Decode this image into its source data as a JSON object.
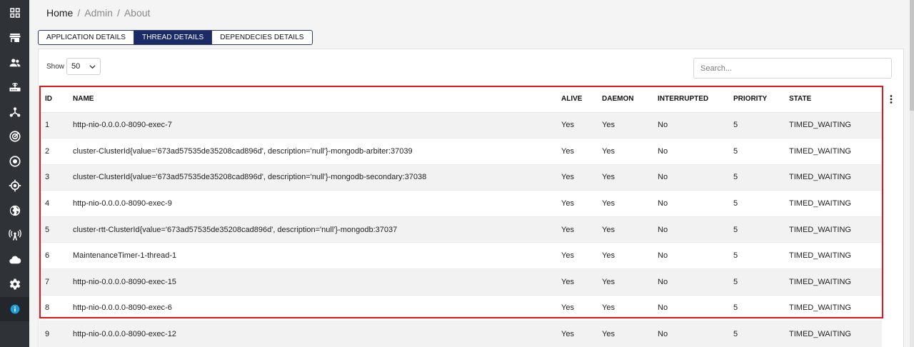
{
  "breadcrumb": {
    "home": "Home",
    "sep": "/",
    "admin": "Admin",
    "about": "About"
  },
  "tabs": [
    "APPLICATION DETAILS",
    "THREAD DETAILS",
    "DEPENDECIES DETAILS"
  ],
  "active_tab": "THREAD DETAILS",
  "controls": {
    "show_label": "Show",
    "show_value": "50",
    "search_placeholder": "Search..."
  },
  "sidebar": {
    "items": [
      "dashboard-icon",
      "store-icon",
      "users-icon",
      "router-icon",
      "network-icon",
      "radar-icon",
      "target-icon",
      "crosshair-icon",
      "globe-icon",
      "antenna-icon",
      "cloud-icon",
      "gear-icon",
      "info-icon"
    ],
    "active": "info-icon",
    "active_color": "#1e9bd7"
  },
  "table": {
    "columns": [
      "ID",
      "NAME",
      "ALIVE",
      "DAEMON",
      "INTERRUPTED",
      "PRIORITY",
      "STATE"
    ],
    "rows": [
      [
        "1",
        "http-nio-0.0.0.0-8090-exec-7",
        "Yes",
        "Yes",
        "No",
        "5",
        "TIMED_WAITING"
      ],
      [
        "2",
        "cluster-ClusterId{value='673ad57535de35208cad896d', description='null'}-mongodb-arbiter:37039",
        "Yes",
        "Yes",
        "No",
        "5",
        "TIMED_WAITING"
      ],
      [
        "3",
        "cluster-ClusterId{value='673ad57535de35208cad896d', description='null'}-mongodb-secondary:37038",
        "Yes",
        "Yes",
        "No",
        "5",
        "TIMED_WAITING"
      ],
      [
        "4",
        "http-nio-0.0.0.0-8090-exec-9",
        "Yes",
        "Yes",
        "No",
        "5",
        "TIMED_WAITING"
      ],
      [
        "5",
        "cluster-rtt-ClusterId{value='673ad57535de35208cad896d', description='null'}-mongodb:37037",
        "Yes",
        "Yes",
        "No",
        "5",
        "TIMED_WAITING"
      ],
      [
        "6",
        "MaintenanceTimer-1-thread-1",
        "Yes",
        "Yes",
        "No",
        "5",
        "TIMED_WAITING"
      ],
      [
        "7",
        "http-nio-0.0.0.0-8090-exec-15",
        "Yes",
        "Yes",
        "No",
        "5",
        "TIMED_WAITING"
      ],
      [
        "8",
        "http-nio-0.0.0.0-8090-exec-6",
        "Yes",
        "Yes",
        "No",
        "5",
        "TIMED_WAITING"
      ],
      [
        "9",
        "http-nio-0.0.0.0-8090-exec-12",
        "Yes",
        "Yes",
        "No",
        "5",
        "TIMED_WAITING"
      ]
    ]
  },
  "colors": {
    "highlight": "#e0161c",
    "tab_active": "#1b2b66",
    "sidebar_bg": "#2f3338"
  }
}
